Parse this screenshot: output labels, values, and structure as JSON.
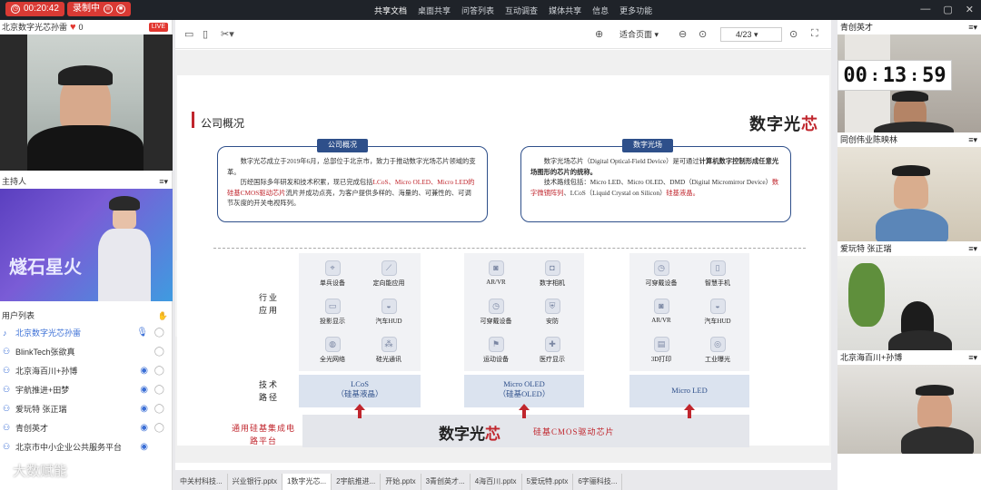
{
  "topbar": {
    "timer": "00:20:42",
    "recording": "录制中",
    "tabs": [
      "共享文档",
      "桌面共享",
      "问答列表",
      "互动调查",
      "媒体共享",
      "信息",
      "更多功能"
    ]
  },
  "left": {
    "presenter_name": "北京数字光芯孙雷",
    "likes": "0",
    "live_badge": "LIVE",
    "host_label": "主持人",
    "host_banner_text": "燧石星火",
    "user_list_label": "用户列表",
    "users": [
      "北京数字光芯孙雷",
      "BlinkTech张欲真",
      "北京海百川+孙博",
      "宇航推进+田梦",
      "爱玩特 张正瑞",
      "青创英才",
      "北京市中小企业公共服务平台"
    ],
    "watermark": "大数赋能"
  },
  "toolbar": {
    "fit": "适合页面",
    "page": "4/23"
  },
  "slide": {
    "title": "公司概况",
    "logo_main": "数字光",
    "logo_accent": "芯",
    "box1": {
      "badge": "公司概况",
      "p1_a": "数字光芯成立于2019年6月，总部位于北京市，致力于推动数字光场芯片领域的变革。",
      "p2_a": "历经国际多年研发和技术积累，现已完成包括",
      "p2_b": "LCoS、Micro OLED、Micro LED的硅基CMOS驱动芯片",
      "p2_c": "流片并成功点亮，为客户提供多样的、海量的、可兼性的、可调节灰度的开关电视阵列。"
    },
    "box2": {
      "badge": "数字光场",
      "p1_a": "数字光场芯片（Digital Optical-Field Device）是可通过",
      "p1_b": "计算机数字控制形成任意光场图形的芯片的统称。",
      "p2_a": "技术路线包括：Micro LED、Micro OLED、DMD（Digital Micromirror Device）",
      "p2_b": "数字微镜阵列",
      "p2_c": "、LCoS（Liquid Crystal on Silicon）",
      "p2_d": "硅基液晶。"
    },
    "row_label_apps": "行业应用",
    "row_label_tech": "技术路径",
    "row_label_base": "通用硅基集成电路平台",
    "group1_apps": [
      "单兵设备",
      "定向能应用",
      "投影显示",
      "汽车HUD",
      "全光网络",
      "硅光通讯"
    ],
    "group2_apps": [
      "AR/VR",
      "数字相机",
      "可穿戴设备",
      "安防",
      "运动设备",
      "医疗显示"
    ],
    "group3_apps": [
      "可穿戴设备",
      "智慧手机",
      "AR/VR",
      "汽车HUD",
      "3D打印",
      "工业曝光"
    ],
    "tech1": [
      "LCoS",
      "（硅基液晶）"
    ],
    "tech2": [
      "Micro OLED",
      "（硅基OLED）"
    ],
    "tech3": [
      "Micro LED"
    ],
    "base_logo_main": "数字光",
    "base_logo_accent": "芯",
    "base_text": "硅基CMOS驱动芯片"
  },
  "bottom_tabs": [
    "中关村科技...",
    "兴业银行.pptx",
    "1数字光芯...",
    "2宇航推进...",
    "开始.pptx",
    "3青创英才...",
    "4海百川.pptx",
    "5爱玩特.pptx",
    "6字骊科技..."
  ],
  "right": {
    "v1_label": "青创英才",
    "timer": {
      "hh": "00",
      "mm": "13",
      "ss": "59"
    },
    "v2_label": "同创伟业陈映林",
    "v3_label": "爱玩特 张正瑞",
    "v4_label": "北京海百川+孙博"
  },
  "colors": {
    "accent": "#c0262d",
    "navy": "#2e4f8a",
    "live": "#e2362f"
  }
}
